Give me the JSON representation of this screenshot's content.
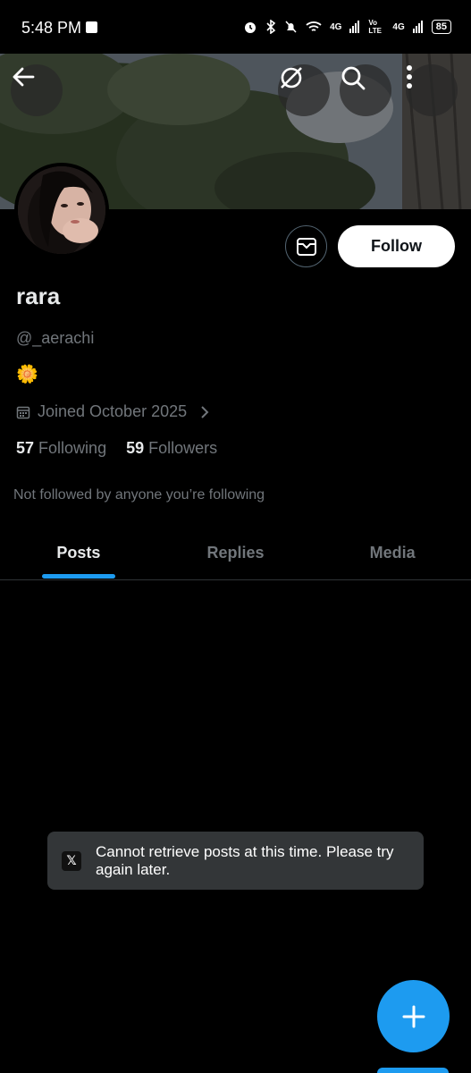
{
  "status_bar": {
    "time": "5:48 PM",
    "net1": "4G",
    "volte": "Vo LTE",
    "net2": "4G",
    "battery": "85"
  },
  "profile": {
    "name": "rara",
    "handle": "@_aerachi",
    "bio_emoji": "🌼",
    "joined": "Joined October 2025",
    "following_count": "57",
    "following_label": "Following",
    "followers_count": "59",
    "followers_label": "Followers",
    "not_followed_text": "Not followed by anyone you’re following"
  },
  "actions": {
    "follow_label": "Follow"
  },
  "tabs": [
    {
      "label": "Posts",
      "active": true
    },
    {
      "label": "Replies",
      "active": false
    },
    {
      "label": "Media",
      "active": false
    }
  ],
  "toast": {
    "icon": "𝕏",
    "message": "Cannot retrieve posts at this time. Please try again later."
  },
  "colors": {
    "accent": "#1d9bf0",
    "background": "#000000",
    "secondary_text": "#71767b"
  },
  "icons": [
    "back-arrow-icon",
    "grok-icon",
    "search-icon",
    "more-vertical-icon",
    "mail-icon",
    "calendar-icon",
    "chevron-right-icon",
    "x-logo-icon",
    "plus-icon"
  ]
}
